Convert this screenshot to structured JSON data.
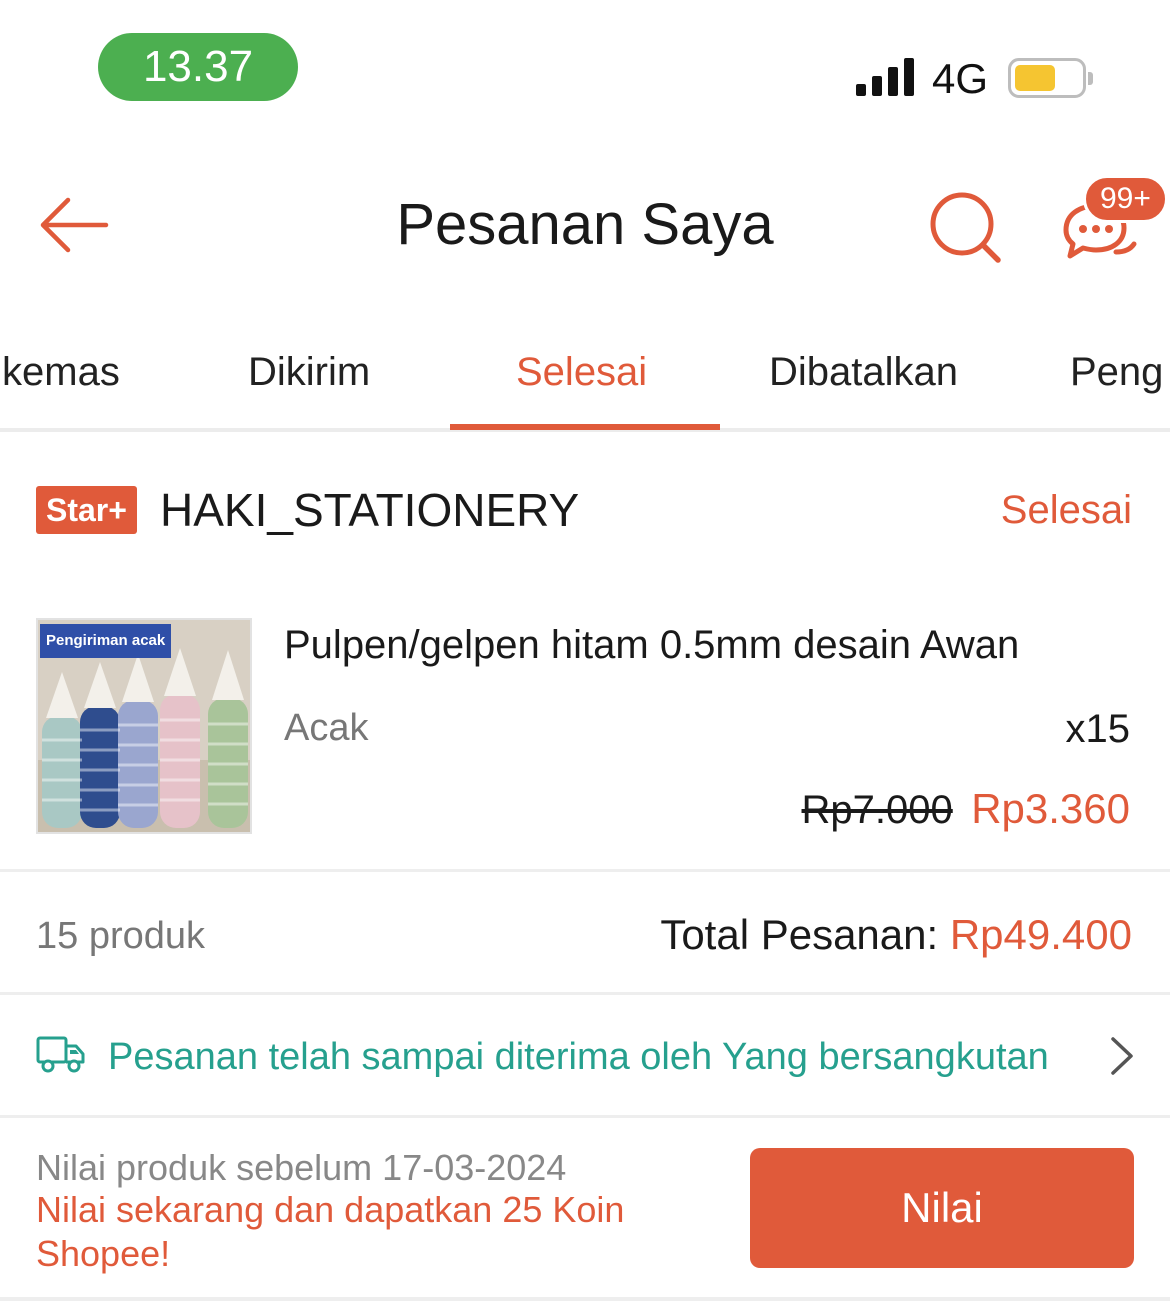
{
  "status_bar": {
    "time": "13.37",
    "network": "4G"
  },
  "header": {
    "title": "Pesanan Saya",
    "chat_badge": "99+"
  },
  "tabs": [
    {
      "label": "kemas",
      "active": false
    },
    {
      "label": "Dikirim",
      "active": false
    },
    {
      "label": "Selesai",
      "active": true
    },
    {
      "label": "Dibatalkan",
      "active": false
    },
    {
      "label": "Peng",
      "active": false
    }
  ],
  "order": {
    "shop_badge": "Star+",
    "shop_name": "HAKI_STATIONERY",
    "status": "Selesai",
    "product": {
      "image_banner": "Pengiriman acak",
      "name": "Pulpen/gelpen hitam 0.5mm desain Awan",
      "variant": "Acak",
      "quantity": "x15",
      "original_price": "Rp7.000",
      "price": "Rp3.360"
    },
    "item_count": "15 produk",
    "total_label": "Total Pesanan: ",
    "total_amount": "Rp49.400",
    "shipping_status": "Pesanan telah sampai diterima oleh Yang bersangkutan",
    "rating": {
      "deadline": "Nilai produk sebelum 17-03-2024",
      "promo": "Nilai sekarang dan dapatkan 25 Koin Shopee!",
      "button_label": "Nilai"
    }
  },
  "colors": {
    "accent": "#e05a3a",
    "time_pill": "#4caf50",
    "shipping_teal": "#26a08e",
    "battery": "#f5c531"
  },
  "icons": [
    "back-arrow-icon",
    "search-icon",
    "chat-icon",
    "truck-icon",
    "chevron-right-icon",
    "signal-icon",
    "battery-icon"
  ]
}
